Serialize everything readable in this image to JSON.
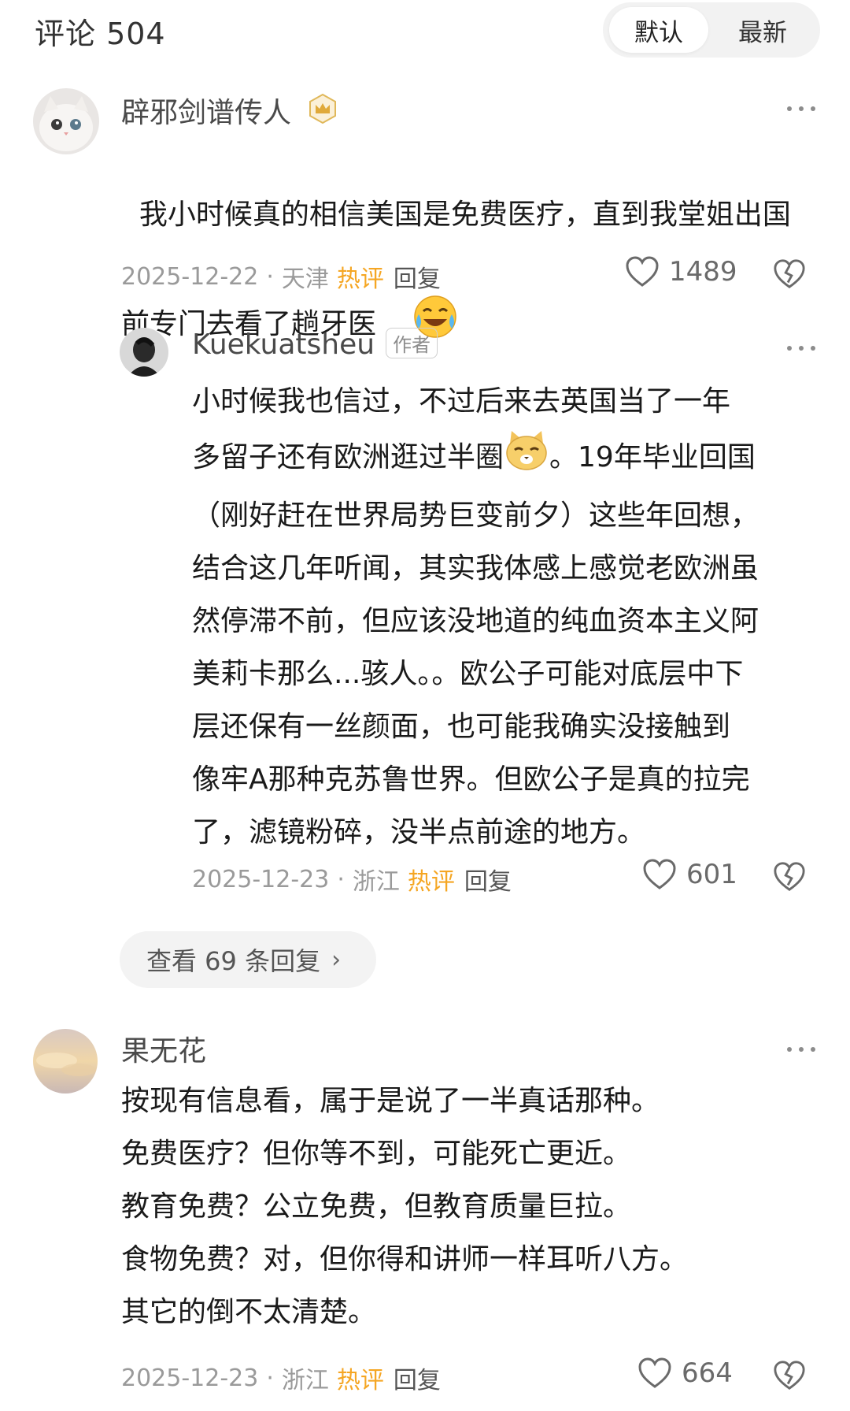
{
  "header": {
    "title": "评论 504",
    "sort_default": "默认",
    "sort_latest": "最新"
  },
  "comments": [
    {
      "username": "辟邪剑谱传人",
      "text": "我小时候真的相信美国是免费医疗，直到我堂姐出国前专门去看了趟牙医",
      "date": "2025-12-22",
      "location": "天津",
      "hot": "热评",
      "reply": "回复",
      "likes": "1489"
    },
    {
      "username": "Kuekuatsheu",
      "badge": "作者",
      "text_line1": "小时候我也信过，不过后来去英国当了一年",
      "text_line2a": "多留子还有欧洲逛过半圈",
      "text_line2b": "。19年毕业回国",
      "text_rest": "（刚好赶在世界局势巨变前夕）这些年回想，\n结合这几年听闻，其实我体感上感觉老欧洲虽\n然停滞不前，但应该没地道的纯血资本主义阿\n美莉卡那么...骇人。。欧公子可能对底层中下\n层还保有一丝颜面，也可能我确实没接触到\n像牢A那种克苏鲁世界。但欧公子是真的拉完\n了，滤镜粉碎，没半点前途的地方。",
      "date": "2025-12-23",
      "location": "浙江",
      "hot": "热评",
      "reply": "回复",
      "likes": "601"
    },
    {
      "username": "果无花",
      "text": "按现有信息看，属于是说了一半真话那种。\n免费医疗？但你等不到，可能死亡更近。\n教育免费？公立免费，但教育质量巨拉。\n食物免费？对，但你得和讲师一样耳听八方。\n其它的倒不太清楚。",
      "date": "2025-12-23",
      "location": "浙江",
      "hot": "热评",
      "reply": "回复",
      "likes": "664"
    }
  ],
  "view_replies": "查看 69 条回复",
  "colors": {
    "hot": "#f5a623",
    "meta": "#9a9a9a",
    "username": "#4a4a4a"
  }
}
